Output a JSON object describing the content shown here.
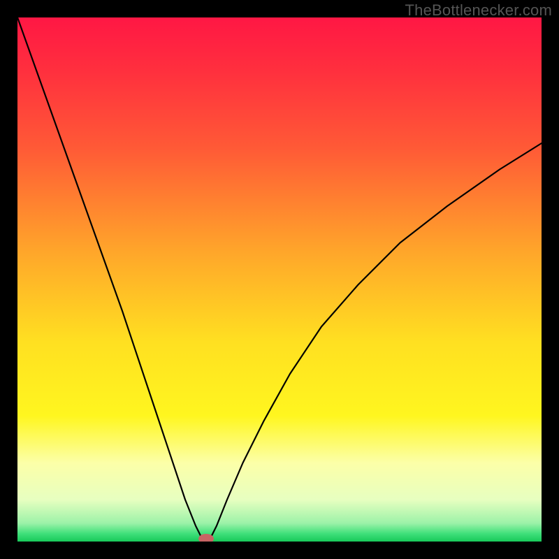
{
  "watermark": "TheBottlenecker.com",
  "chart_data": {
    "type": "line",
    "title": "",
    "xlabel": "",
    "ylabel": "",
    "xlim": [
      0,
      100
    ],
    "ylim": [
      0,
      100
    ],
    "optimal_x": 36,
    "series": [
      {
        "name": "bottleneck-curve",
        "x": [
          0,
          5,
          10,
          15,
          20,
          25,
          28,
          30,
          32,
          34,
          35,
          36,
          37,
          38,
          40,
          43,
          47,
          52,
          58,
          65,
          73,
          82,
          92,
          100
        ],
        "values": [
          100,
          86,
          72,
          58,
          44,
          29,
          20,
          14,
          8,
          3,
          1,
          0,
          1,
          3,
          8,
          15,
          23,
          32,
          41,
          49,
          57,
          64,
          71,
          76
        ]
      }
    ],
    "marker": {
      "x": 36,
      "y": 0,
      "color": "#c86464"
    },
    "gradient_stops": [
      {
        "offset": 0,
        "color": "#ff1744"
      },
      {
        "offset": 0.1,
        "color": "#ff2f3e"
      },
      {
        "offset": 0.25,
        "color": "#ff5a36"
      },
      {
        "offset": 0.45,
        "color": "#ffa72a"
      },
      {
        "offset": 0.62,
        "color": "#ffe021"
      },
      {
        "offset": 0.76,
        "color": "#fff61f"
      },
      {
        "offset": 0.85,
        "color": "#fcffa8"
      },
      {
        "offset": 0.92,
        "color": "#e7ffc0"
      },
      {
        "offset": 0.965,
        "color": "#9cf2a8"
      },
      {
        "offset": 0.985,
        "color": "#3fe07a"
      },
      {
        "offset": 1.0,
        "color": "#18c95a"
      }
    ]
  }
}
